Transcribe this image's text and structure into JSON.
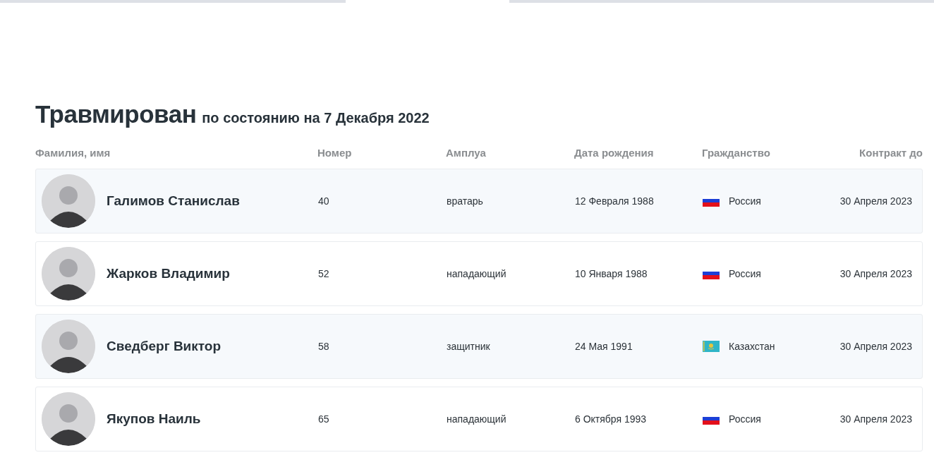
{
  "title": "Травмирован",
  "subtitle": "по состоянию на 7 Декабря 2022",
  "columns": [
    "Фамилия, имя",
    "Номер",
    "Амплуа",
    "Дата рождения",
    "Гражданство",
    "Контракт до"
  ],
  "rows": [
    {
      "name": "Галимов Станислав",
      "number": "40",
      "position": "вратарь",
      "birth_date": "12 Февраля 1988",
      "kind": "ru",
      "citizenship": "Россия",
      "contract_until": "30 Апреля 2023"
    },
    {
      "name": "Жарков Владимир",
      "number": "52",
      "position": "нападающий",
      "birth_date": "10 Января 1988",
      "kind": "ru",
      "citizenship": "Россия",
      "contract_until": "30 Апреля 2023"
    },
    {
      "name": "Сведберг Виктор",
      "number": "58",
      "position": "защитник",
      "birth_date": "24 Мая 1991",
      "kind": "kz",
      "citizenship": "Казахстан",
      "contract_until": "30 Апреля 2023"
    },
    {
      "name": "Якупов Наиль",
      "number": "65",
      "position": "нападающий",
      "birth_date": "6 Октября 1993",
      "kind": "ru",
      "citizenship": "Россия",
      "contract_until": "30 Апреля 2023"
    }
  ]
}
